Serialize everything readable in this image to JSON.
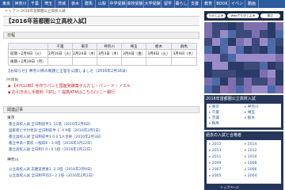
{
  "nav": [
    "東京",
    "神奈川",
    "千葉",
    "埼玉",
    "茨城",
    "栃木",
    "群馬",
    "山梨",
    "中学受験",
    "高校受験",
    "大学受験",
    "留学",
    "暮らし",
    "支援",
    "教育",
    "BOOK",
    "イベント",
    "動画"
  ],
  "breadcrumb": {
    "home": "トップ",
    "sep": " > ",
    "current": "2016年首都圏公立高校入試"
  },
  "page_title": "【2016年首都圏公立高校入試】",
  "schedule": {
    "heading": "日程",
    "headers": [
      "",
      "千葉",
      "東京",
      "神奈川",
      "埼玉",
      "栃木",
      "群馬"
    ],
    "rows": [
      [
        "前期・2月9日（火）",
        "2月16日（火）",
        "2月24日（水）",
        "3月3日（木）",
        "3月4日（金）",
        "3月8日（火）",
        "3月9日（水）"
      ],
      [
        "後期・2月29日（月）",
        "",
        "",
        "",
        "",
        "",
        ""
      ]
    ]
  },
  "bulletin_text": "【お知らせ】神奈川県の問題と正答を公開しました（2016年2月16日）",
  "pr": {
    "label": "PR情報",
    "items": [
      "【47CLUB】手作りパンと国産発酵菓子んだし・パン・ド・ノエル",
      "お引き出し手数料「0円」！提携ATMはこちら/ソニー銀行"
    ]
  },
  "related": {
    "heading": "関連記事",
    "groups": [
      {
        "name": "東京",
        "items": [
          "都立高校入試 全日制前半1. 51倍（2016年2月6日）",
          "国家者ビザ付状況 全日制前半 1. 4 9倍（2016年2月5日）",
          "都立高校入試 全日制前半1 0 0 5人合格（2016年2月3日）",
          "都立中高一貫校 一般枠6・3 4倍（2016年1月22日）",
          "都立高校入試 全日制1 0・0 5倍（2016年1月22日）"
        ]
      },
      {
        "name": "神奈川",
        "items": [
          "公立高校入試 志願変更後1. 2 2倍（2016年2月9日）",
          "公立高校入試 全日制平均1・2 2倍（2016年2月2日）"
        ]
      }
    ]
  },
  "sidebar": {
    "search_buttons": [
      "たのしよみ",
      "Webでたのしよみ",
      "都立"
    ],
    "admission_title": "2016年首都圏公立高校入試",
    "admission_items": [
      "東京",
      "神奈川",
      "千葉",
      "埼玉",
      "茨城",
      "栃木",
      "群馬"
    ],
    "archive_title": "過去の入試と合格者",
    "years": [
      "2015",
      "2014",
      "2013",
      "2012",
      "2011",
      "2010",
      "2009",
      "2008",
      "2007",
      "2006",
      "2005",
      "2004"
    ],
    "top_link": "トップページ"
  }
}
